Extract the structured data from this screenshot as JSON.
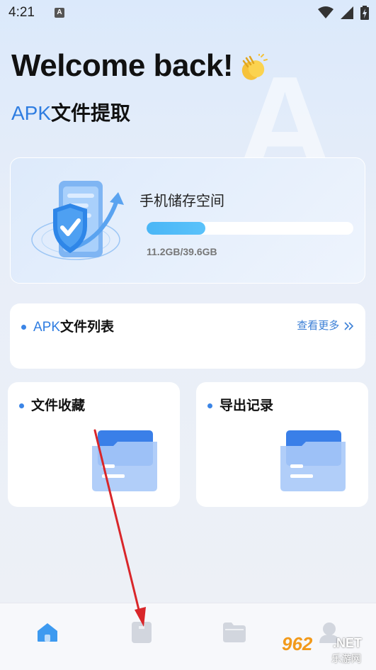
{
  "status_bar": {
    "time": "4:21",
    "notification_icon_letter": "A",
    "icons": [
      "wifi-icon",
      "signal-icon",
      "battery-charging-icon"
    ]
  },
  "header": {
    "welcome": "Welcome back!",
    "welcome_icon": "clapping-hands-icon",
    "subtitle_apk": "APK",
    "subtitle_cn": "文件提取",
    "background_letter": "A"
  },
  "storage": {
    "title": "手机储存空间",
    "used_gb": 11.2,
    "total_gb": 39.6,
    "usage_text": "11.2GB/39.6GB",
    "progress_fraction": 0.283,
    "bar_color": "#4ab6f6"
  },
  "apk_list": {
    "title_apk": "APK",
    "title_cn": "文件列表",
    "see_more": "查看更多",
    "see_more_icon": "double-chevron-right-icon"
  },
  "favorites": {
    "title": "文件收藏"
  },
  "export_records": {
    "title": "导出记录"
  },
  "bottom_nav": {
    "items": [
      {
        "name": "home",
        "icon": "home-icon",
        "active": true
      },
      {
        "name": "apk",
        "icon": "document-icon",
        "active": false
      },
      {
        "name": "folder",
        "icon": "folder-icon",
        "active": false
      },
      {
        "name": "profile",
        "icon": "user-icon",
        "active": false
      }
    ]
  },
  "watermark": {
    "main": "962",
    "suffix": ".NET",
    "sub": "乐游网"
  },
  "colors": {
    "accent": "#2f7de1",
    "active_nav": "#3d9af0",
    "annotation_arrow": "#d9262a"
  }
}
